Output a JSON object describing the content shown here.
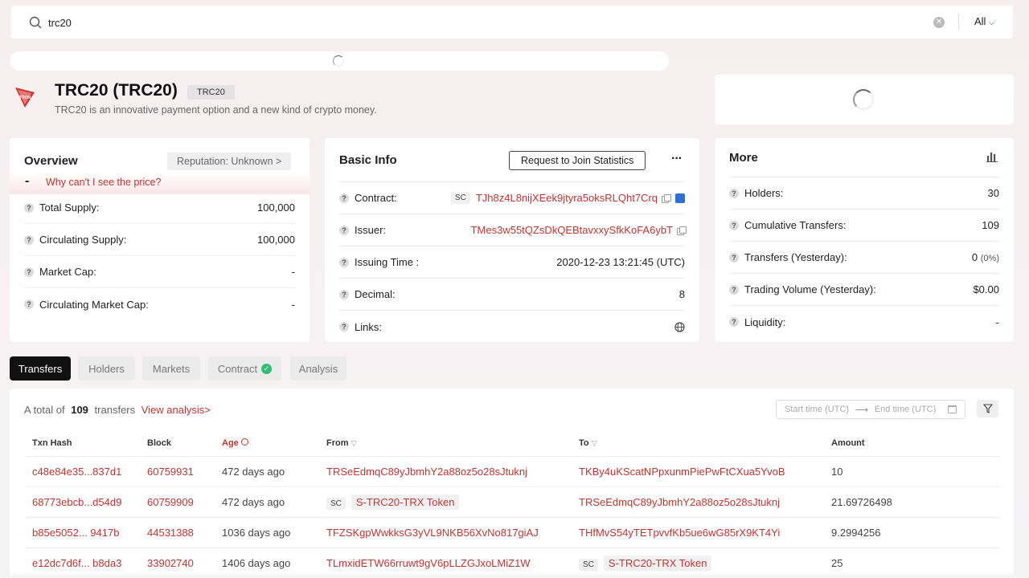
{
  "search": {
    "value": "trc20",
    "scope": "All"
  },
  "token": {
    "name": "TRC20 (TRC20)",
    "symbol_badge": "TRC20",
    "description": "TRC20 is an innovative payment option and a new kind of crypto money."
  },
  "overview": {
    "title": "Overview",
    "reputation": "Reputation: Unknown >",
    "price": "-",
    "price_link": "Why can't I see the price?",
    "rows": [
      {
        "label": "Total Supply:",
        "value": "100,000"
      },
      {
        "label": "Circulating Supply:",
        "value": "100,000"
      },
      {
        "label": "Market Cap:",
        "value": "-"
      },
      {
        "label": "Circulating Market Cap:",
        "value": "-"
      }
    ]
  },
  "basic": {
    "title": "Basic Info",
    "join_button": "Request to Join Statistics",
    "more_glyph": "···",
    "contract_label": "Contract:",
    "contract_tag": "SC",
    "contract_value": "TJh8z4L8nijXEek9jtyra5oksRLQht7Crq",
    "issuer_label": "Issuer:",
    "issuer_value": "TMes3w55tQZsDkQEBtavxxySfkKoFA6ybT",
    "time_label": "Issuing Time :",
    "time_value": "2020-12-23 13:21:45 (UTC)",
    "decimal_label": "Decimal:",
    "decimal_value": "8",
    "links_label": "Links:"
  },
  "more": {
    "title": "More",
    "holders_label": "Holders:",
    "holders_value": "30",
    "cum_label": "Cumulative Transfers:",
    "cum_value": "109",
    "ty_label": "Transfers (Yesterday):",
    "ty_value": "0",
    "ty_pct": "(0%)",
    "tv_label": "Trading Volume (Yesterday):",
    "tv_value": "$0.00",
    "liq_label": "Liquidity:",
    "liq_value": "-"
  },
  "tabs": [
    "Transfers",
    "Holders",
    "Markets",
    "Contract",
    "Analysis"
  ],
  "transfers": {
    "total_prefix": "A total of",
    "total_count": "109",
    "total_suffix": "transfers",
    "view_analysis": "View analysis>",
    "start_placeholder": "Start time (UTC)",
    "end_placeholder": "End time (UTC)",
    "columns": [
      "Txn Hash",
      "Block",
      "Age",
      "From",
      "To",
      "Amount"
    ],
    "rows": [
      {
        "hash": "c48e84e35...837d1",
        "block": "60759931",
        "age": "472 days ago",
        "from": "TRSeEdmqC89yJbmhY2a88oz5o28sJtuknj",
        "from_tag": "",
        "to": "TKBy4uKScatNPpxunmPiePwFtCXua5YvoB",
        "to_tag": "",
        "amount": "10"
      },
      {
        "hash": "68773ebcb...d54d9",
        "block": "60759909",
        "age": "472 days ago",
        "from": "S-TRC20-TRX Token",
        "from_tag": "SC",
        "to": "TRSeEdmqC89yJbmhY2a88oz5o28sJtuknj",
        "to_tag": "",
        "amount": "21.69726498"
      },
      {
        "hash": "b85e5052... 9417b",
        "block": "44531388",
        "age": "1036 days ago",
        "from": "TFZSKgpWwkksG3yVL9NKB56XvNo817giAJ",
        "from_tag": "",
        "to": "THfMvS54yTETpvvfKb5ue6wG85rX9KT4Yi",
        "to_tag": "",
        "amount": "9.2994256"
      },
      {
        "hash": "e12dc7d6f... b8da3",
        "block": "33902740",
        "age": "1406 days ago",
        "from": "TLmxidETW66rruwt9gV6pLLZGJxoLMiZ1W",
        "from_tag": "",
        "to": "S-TRC20-TRX Token",
        "to_tag": "SC",
        "amount": "25"
      }
    ]
  }
}
